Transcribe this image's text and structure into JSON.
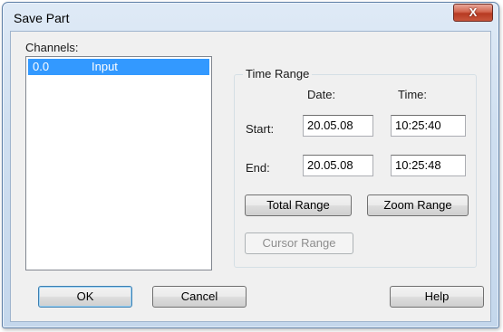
{
  "window": {
    "title": "Save Part",
    "close_label": "X"
  },
  "channels": {
    "label": "Channels:",
    "items": [
      {
        "id": "0.0",
        "name": "Input",
        "selected": true
      }
    ]
  },
  "time_range": {
    "label": "Time Range",
    "date_header": "Date:",
    "time_header": "Time:",
    "start_label": "Start:",
    "end_label": "End:",
    "start_date": "20.05.08",
    "start_time": "10:25:40",
    "end_date": "20.05.08",
    "end_time": "10:25:48",
    "total_range_label": "Total Range",
    "zoom_range_label": "Zoom Range",
    "cursor_range_label": "Cursor Range"
  },
  "buttons": {
    "ok": "OK",
    "cancel": "Cancel",
    "help": "Help"
  },
  "colors": {
    "selection": "#3399ff",
    "close_button": "#c8563c",
    "frame": "#cfdff0"
  }
}
